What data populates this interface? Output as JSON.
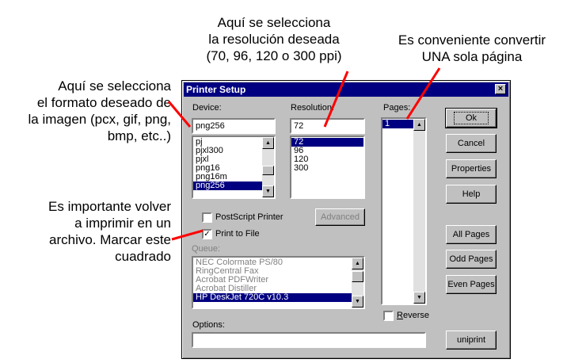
{
  "annotations": {
    "resolution": [
      "Aquí se selecciona",
      "la resolución deseada",
      "(70, 96, 120 o 300 ppi)"
    ],
    "pages": [
      "Es conveniente convertir",
      "UNA sola página"
    ],
    "format": [
      "Aquí se selecciona",
      "el formato deseado de",
      "la imagen (pcx, gif, png,",
      "bmp, etc..)"
    ],
    "print_to_file": [
      "Es importante volver",
      "a imprimir en un",
      "archivo. Marcar este",
      "cuadrado"
    ]
  },
  "dialog": {
    "title": "Printer Setup",
    "close_glyph": "×",
    "device": {
      "label": "Device:",
      "value": "png256",
      "items": [
        "pj",
        "pjxl300",
        "pjxl",
        "png16",
        "png16m",
        "png256"
      ],
      "selected": "png256"
    },
    "resolution": {
      "label": "Resolution:",
      "value": "72",
      "items": [
        "72",
        "96",
        "120",
        "300"
      ],
      "selected": "72"
    },
    "pages": {
      "label": "Pages:",
      "items": [
        "1"
      ],
      "selected": "1"
    },
    "postscript_label": "PostScript Printer",
    "postscript_checked": false,
    "print_to_file_label": "Print to File",
    "print_to_file_checked": true,
    "advanced_label": "Advanced",
    "queue": {
      "label": "Queue:",
      "items": [
        "NEC Colormate PS/80",
        "RingCentral Fax",
        "Acrobat PDFWriter",
        "Acrobat Distiller",
        "HP DeskJet 720C v10.3"
      ],
      "selected": "HP DeskJet 720C v10.3"
    },
    "options_label": "Options:",
    "options_value": "",
    "reverse_label": "Reverse",
    "reverse_checked": false,
    "buttons": {
      "ok": "Ok",
      "cancel": "Cancel",
      "properties": "Properties",
      "help": "Help",
      "all_pages": "All Pages",
      "odd_pages": "Odd Pages",
      "even_pages": "Even Pages",
      "uniprint": "uniprint"
    },
    "check_glyph": "✓",
    "scroll_up_glyph": "▲",
    "scroll_down_glyph": "▼"
  },
  "colors": {
    "title_bar": "#000080",
    "face": "#c0c0c0",
    "selection": "#000080",
    "arrow": "#ff0000"
  }
}
